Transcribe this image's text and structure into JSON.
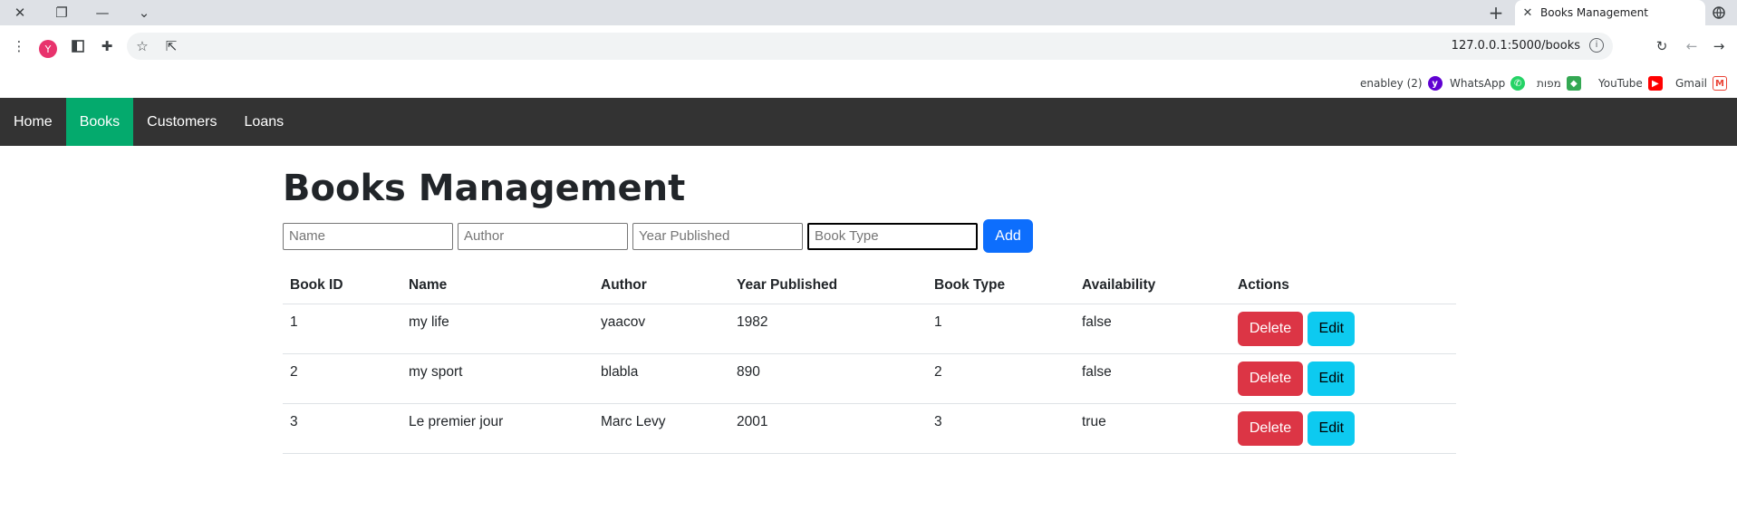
{
  "browser": {
    "tab_title": "Books Management",
    "url": "127.0.0.1:5000/books",
    "profile_initial": "Y",
    "bookmarks": [
      {
        "label": "enabley (2)",
        "icon": "yahoo-icon",
        "color": "#6001d2",
        "glyph": "y"
      },
      {
        "label": "WhatsApp",
        "icon": "whatsapp-icon",
        "color": "#25d366",
        "glyph": "✆"
      },
      {
        "label": "מפות",
        "icon": "maps-icon",
        "color": "#34a853",
        "glyph": "◆"
      },
      {
        "label": "YouTube",
        "icon": "youtube-icon",
        "color": "#ff0000",
        "glyph": "▶"
      },
      {
        "label": "Gmail",
        "icon": "gmail-icon",
        "color": "#ea4335",
        "glyph": "M"
      }
    ]
  },
  "nav": {
    "items": [
      {
        "label": "Home",
        "active": false
      },
      {
        "label": "Books",
        "active": true
      },
      {
        "label": "Customers",
        "active": false
      },
      {
        "label": "Loans",
        "active": false
      }
    ],
    "active_color": "#04aa6d",
    "bar_color": "#333333"
  },
  "page": {
    "title": "Books Management",
    "form": {
      "name_placeholder": "Name",
      "author_placeholder": "Author",
      "year_placeholder": "Year Published",
      "type_placeholder": "Book Type",
      "add_label": "Add"
    },
    "table": {
      "headers": [
        "Book ID",
        "Name",
        "Author",
        "Year Published",
        "Book Type",
        "Availability",
        "Actions"
      ],
      "rows": [
        {
          "id": "1",
          "name": "my life",
          "author": "yaacov",
          "year": "1982",
          "type": "1",
          "availability": "false"
        },
        {
          "id": "2",
          "name": "my sport",
          "author": "blabla",
          "year": "890",
          "type": "2",
          "availability": "false"
        },
        {
          "id": "3",
          "name": "Le premier jour",
          "author": "Marc Levy",
          "year": "2001",
          "type": "3",
          "availability": "true"
        }
      ],
      "delete_label": "Delete",
      "edit_label": "Edit"
    }
  }
}
